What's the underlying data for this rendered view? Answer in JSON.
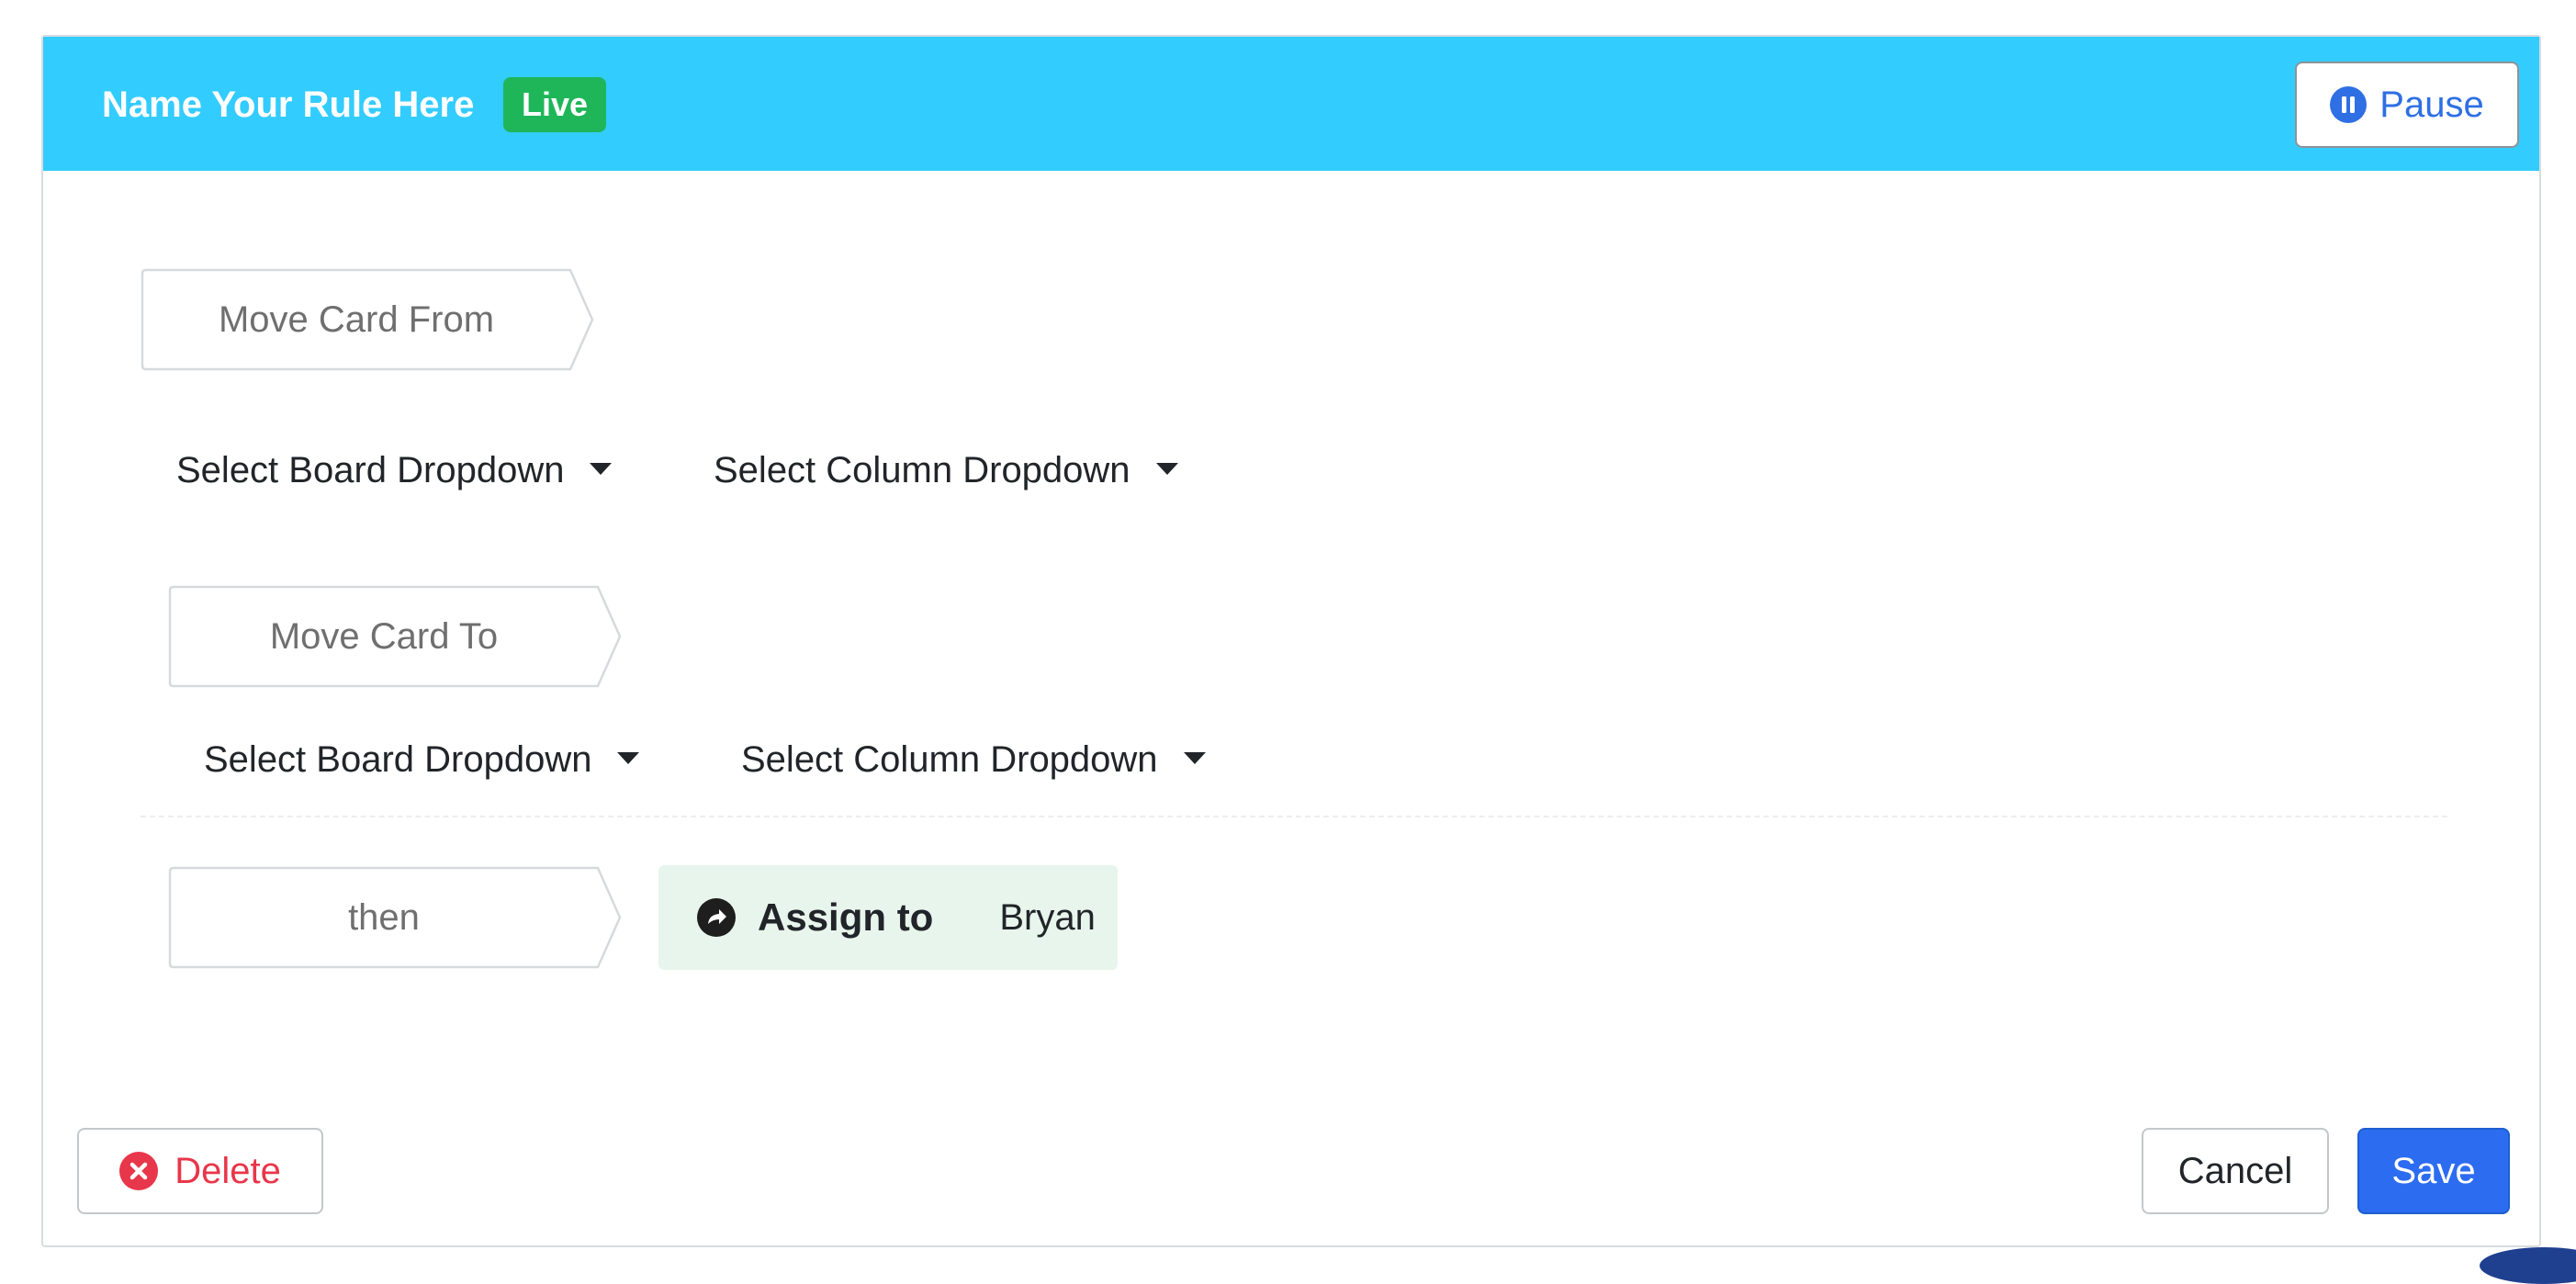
{
  "header": {
    "rule_name": "Name Your Rule Here",
    "status_badge": "Live",
    "pause_label": "Pause",
    "pause_icon": "pause-circle-icon"
  },
  "trigger": {
    "from_label": "Move Card From",
    "from_board": "Select Board Dropdown",
    "from_column": "Select Column Dropdown",
    "to_label": "Move Card To",
    "to_board": "Select Board Dropdown",
    "to_column": "Select Column Dropdown"
  },
  "action": {
    "then_label": "then",
    "assign_label": "Assign to",
    "assign_value": "Bryan",
    "assign_icon": "arrow-circle-right-icon"
  },
  "footer": {
    "delete_label": "Delete",
    "delete_icon": "x-circle-icon",
    "cancel_label": "Cancel",
    "save_label": "Save"
  },
  "colors": {
    "header_bg": "#33ccff",
    "badge_bg": "#1fb65a",
    "primary": "#2c6cf0",
    "danger": "#e8364a",
    "assign_bg": "#e8f5ec"
  }
}
